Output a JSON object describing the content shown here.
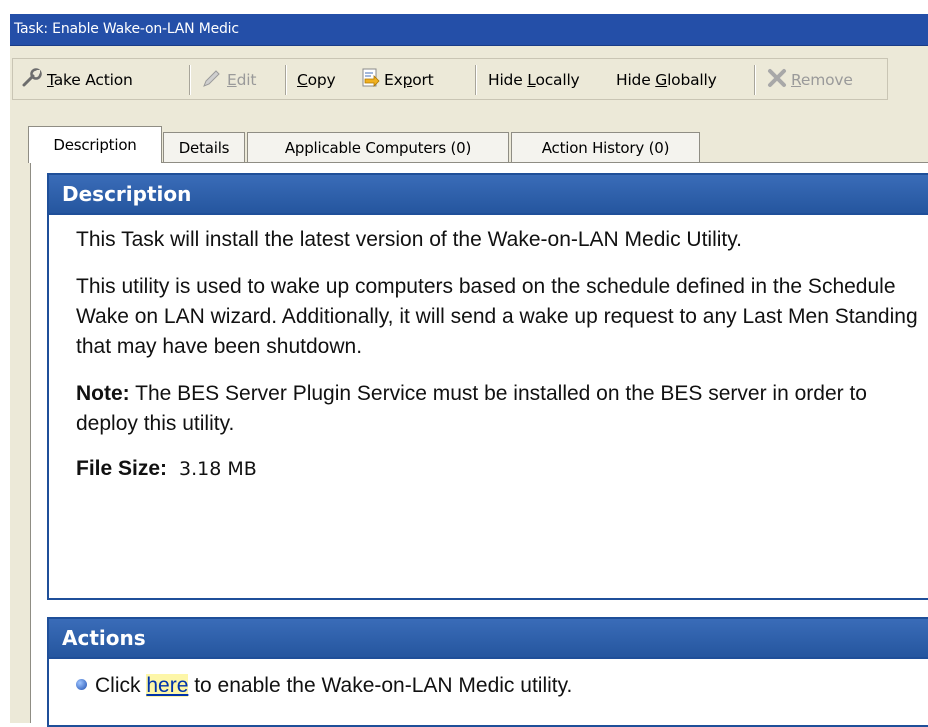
{
  "window": {
    "title": "Task: Enable Wake-on-LAN Medic"
  },
  "toolbar": {
    "take_action": {
      "pre": "",
      "key": "T",
      "post": "ake Action",
      "icon": "wrench-icon"
    },
    "edit": {
      "pre": "",
      "key": "E",
      "post": "dit",
      "icon": "pencil-icon",
      "disabled": true
    },
    "copy": {
      "pre": "",
      "key": "C",
      "post": "opy"
    },
    "export": {
      "pre": "Ex",
      "key": "p",
      "post": "ort",
      "icon": "export-icon"
    },
    "hide_locally": {
      "pre": "Hide ",
      "key": "L",
      "post": "ocally"
    },
    "hide_globally": {
      "pre": "Hide ",
      "key": "G",
      "post": "lobally"
    },
    "remove": {
      "pre": "",
      "key": "R",
      "post": "emove",
      "icon": "x-icon",
      "disabled": true
    }
  },
  "tabs": [
    {
      "label": "Description",
      "active": true
    },
    {
      "label": "Details"
    },
    {
      "label": "Applicable Computers (0)"
    },
    {
      "label": "Action History (0)"
    }
  ],
  "description": {
    "heading": "Description",
    "para1": "This Task will install the latest version of the Wake-on-LAN Medic Utility.",
    "para2": "This utility is used to wake up computers based on the schedule defined in the Schedule Wake on LAN wizard. Additionally, it will send a wake up request to any Last Men Standing that may have been shutdown.",
    "note_label": "Note:",
    "note_text": " The BES Server Plugin Service must be installed on the BES server in order to deploy this utility.",
    "file_size_label": "File Size:",
    "file_size_value": "3.18 MB"
  },
  "actions": {
    "heading": "Actions",
    "pre": "Click ",
    "link": "here",
    "post": " to enable the Wake-on-LAN Medic utility."
  },
  "colors": {
    "titlebar": "#244fa8",
    "panel_header": "#2c5ea8",
    "link_highlight": "#fdf6a8"
  }
}
